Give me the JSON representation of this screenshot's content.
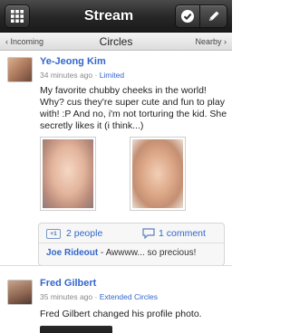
{
  "header": {
    "title": "Stream",
    "left_icon": "grid-icon",
    "right_icons": [
      "check-icon",
      "pencil-icon"
    ]
  },
  "subnav": {
    "left": "‹ Incoming",
    "center": "Circles",
    "right": "Nearby ›"
  },
  "posts": [
    {
      "author": "Ye-Jeong Kim",
      "time": "34 minutes ago",
      "visibility": "Limited",
      "text": "My favorite chubby cheeks in the world! Why? cus they're super cute and fun to play with! :P And no, i'm not torturing the kid. She secretly likes it (i think...)",
      "plus_badge": "+1",
      "plus_count": "2 people",
      "comment_count": "1 comment",
      "comment_author": "Joe Rideout",
      "comment_text": " - Awwww... so precious!"
    },
    {
      "author": "Fred Gilbert",
      "time": "35 minutes ago",
      "visibility": "Extended Circles",
      "text": "Fred Gilbert changed his profile photo."
    }
  ],
  "meta_separator": " · ",
  "colors": {
    "link": "#3366cc",
    "header_bg": "#262626"
  }
}
